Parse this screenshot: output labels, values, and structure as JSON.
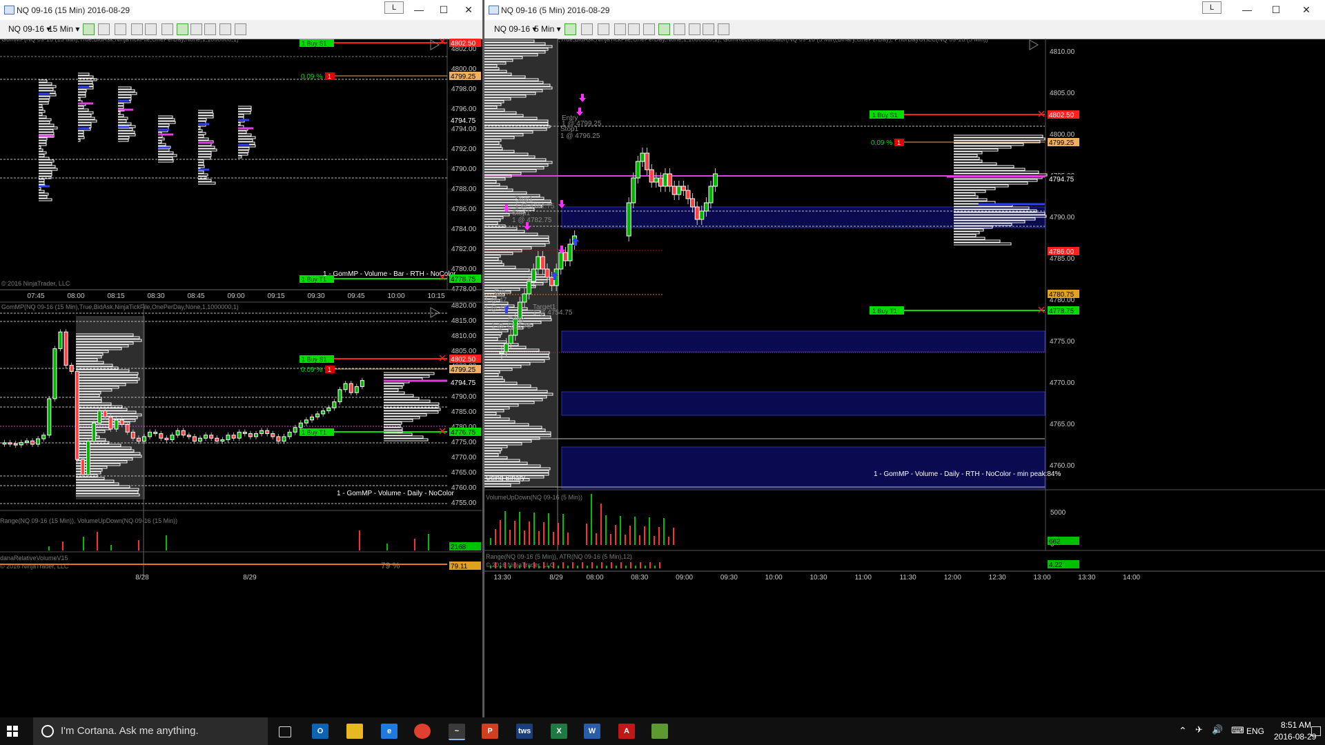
{
  "left_window": {
    "title": "NQ 09-16 (15 Min)  2016-08-29",
    "l_button": "L",
    "instrument": "NQ 09-16",
    "interval": "15 Min",
    "upper_panel": {
      "indicator_label": "GomMP(NQ 09-16 (15 Min),True,BidAsk,NinjaTickFile,OnePerDay,None,1,1000000,1)",
      "y_ticks": [
        "4802.00",
        "4800.00",
        "4798.00",
        "4796.00",
        "4794.00",
        "4792.00",
        "4790.00",
        "4788.00",
        "4786.00",
        "4784.00",
        "4782.00",
        "4780.00",
        "4778.00"
      ],
      "x_ticks": [
        "07:45",
        "08:00",
        "08:15",
        "08:30",
        "08:45",
        "09:00",
        "09:15",
        "09:30",
        "09:45",
        "10:00",
        "10:15"
      ],
      "copyright": "© 2016 NinjaTrader, LLC",
      "buy_s1_label": "1  Buy S1",
      "buy_t1_label": "1  Buy T1",
      "pct_label": "0.09 %",
      "pct_badge": "1",
      "price_tags": [
        "4802.50",
        "4799.25",
        "4794.75",
        "4778.75"
      ],
      "footer_label": "1 - GomMP  - Volume - Bar - RTH - NoColor"
    },
    "lower_panel": {
      "indicator_label": "GomMP(NQ 09-16 (15 Min),True,BidAsk,NinjaTickFile,OnePerDay,None,1,1000000,1)",
      "y_ticks": [
        "4820.00",
        "4815.00",
        "4810.00",
        "4805.00",
        "4800.00",
        "4795.00",
        "4790.00",
        "4785.00",
        "4780.00",
        "4775.00",
        "4770.00",
        "4765.00",
        "4760.00",
        "4755.00"
      ],
      "buy_s1_label": "1  Buy S1",
      "buy_t1_label": "1  Buy T1",
      "pct_label": "0.09 %",
      "pct_badge": "1",
      "price_tags": [
        "4802.50",
        "4799.25",
        "4794.75",
        "4776.75"
      ],
      "footer_label": "1 - GomMP  - Volume - Daily - NoColor",
      "range_label": "Range(NQ 09-16 (15 Min)), VolumeUpDown(NQ 09-16 (15 Min))",
      "range_value": "2168",
      "rel_label": "danaRelativeVolumeV15",
      "rel_copyright": "© 2016 NinjaTrader, LLC",
      "rel_pct": "79 %",
      "rel_value": "79.11",
      "x_ticks": [
        "8/28",
        "8/29"
      ]
    }
  },
  "right_window": {
    "title": "NQ 09-16 (5 Min)  2016-08-29",
    "l_button": "L",
    "instrument": "NQ 09-16",
    "interval": "5 Min",
    "indicator_label": "GomMP(NQ 09-16 (5 Min),True,BidAsk,NinjaTickFile,OnePerDay,None,1,1000000,1), GomRecorderIndicator(NQ 09-16 (5 Min),Binary,OnePerDay), PriorDayOHLC(NQ 09-16 (5 Min))",
    "y_ticks": [
      "4810.00",
      "4805.00",
      "4800.00",
      "4795.00",
      "4790.00",
      "4785.00",
      "4780.00",
      "4775.00",
      "4770.00",
      "4765.00",
      "4760.00"
    ],
    "buy_s1_label": "1  Buy S1",
    "buy_t1_label": "1  Buy T1",
    "pct_label": "0.09 %",
    "pct_badge": "1",
    "price_tags": [
      "4802.50",
      "4799.25",
      "4794.75",
      "4786.00",
      "4780.75",
      "4778.75"
    ],
    "using_binary": "Using Binary",
    "footer_label": "1 - GomMP  - Volume - Daily - RTH - NoColor - min peak:84%",
    "trade_labels": [
      "Entry",
      "1 @ 4799.25",
      "Stop1",
      "1 @ 4796.25",
      "Stop1",
      "1 @ 4782.75",
      "Stop1",
      "1 @ 4782.75",
      "Entry",
      "1 @ 4756.75",
      "Exit",
      "1 @ 47",
      "1 @ 47",
      "Target1",
      "1 @ 4754.75"
    ],
    "volume_label": "VolumeUpDown(NQ 09-16 (5 Min))",
    "volume_tick": "5000",
    "volume_tick_zero": "0",
    "volume_value": "662",
    "range_label": "Range(NQ 09-16 (5 Min)), ATR(NQ 09-16 (5 Min),12)",
    "range_copyright": "© 2016 NinjaTrader, LLC",
    "range_value": "4.22",
    "x_ticks": [
      "13:30",
      "8/29",
      "08:00",
      "08:30",
      "09:00",
      "09:30",
      "10:00",
      "10:30",
      "11:00",
      "11:30",
      "12:00",
      "12:30",
      "13:00",
      "13:30",
      "14:00"
    ]
  },
  "taskbar": {
    "cortana_text": "I'm Cortana. Ask me anything.",
    "language": "ENG",
    "time": "8:51 AM",
    "date": "2016-08-29"
  },
  "colors": {
    "buy_green": "#00dd00",
    "stop_red": "#ff0000",
    "poc_magenta": "#e040e0",
    "value_area_blue": "#0a0a50",
    "candle_up": "#00b400",
    "candle_down": "#ff4040"
  }
}
